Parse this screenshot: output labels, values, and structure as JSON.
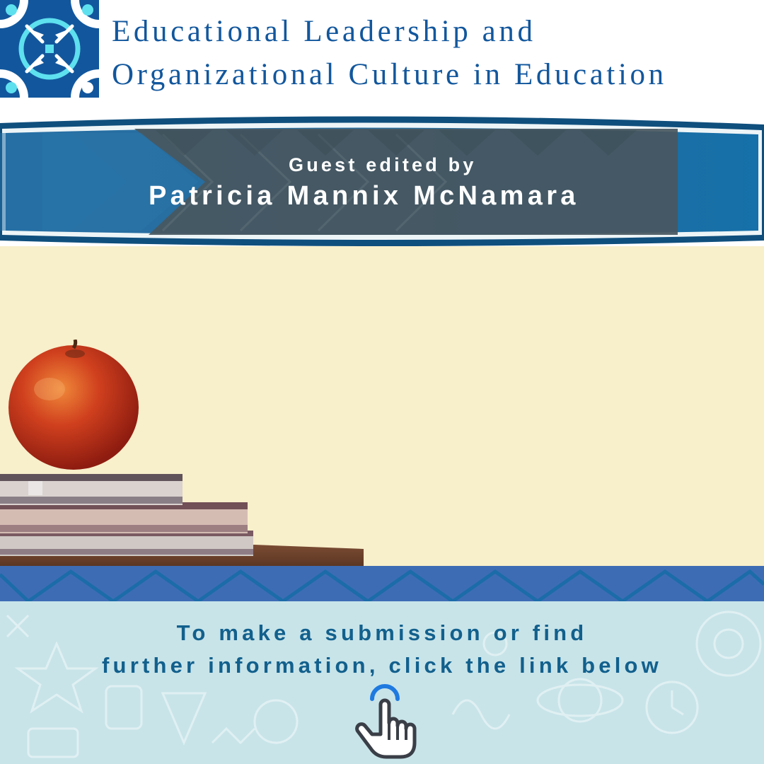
{
  "header": {
    "title_line1": "Educational Leadership and",
    "title_line2": "Organizational Culture in Education",
    "logo_icon": "arrows-inward-quatrefoil-logo"
  },
  "banner": {
    "label": "Guest edited by",
    "editor": "Patricia Mannix McNamara"
  },
  "cta": {
    "line1": "To make a submission or find",
    "line2": "further information, click the link below",
    "icon": "hand-pointer-icon"
  },
  "colors": {
    "title_blue": "#12579d",
    "banner_blue": "#1e6f9e",
    "cream": "#f8efcb",
    "footer_teal": "#c8e4e9",
    "cta_text": "#12608d",
    "zigzag_blue": "#3d6cb5"
  }
}
